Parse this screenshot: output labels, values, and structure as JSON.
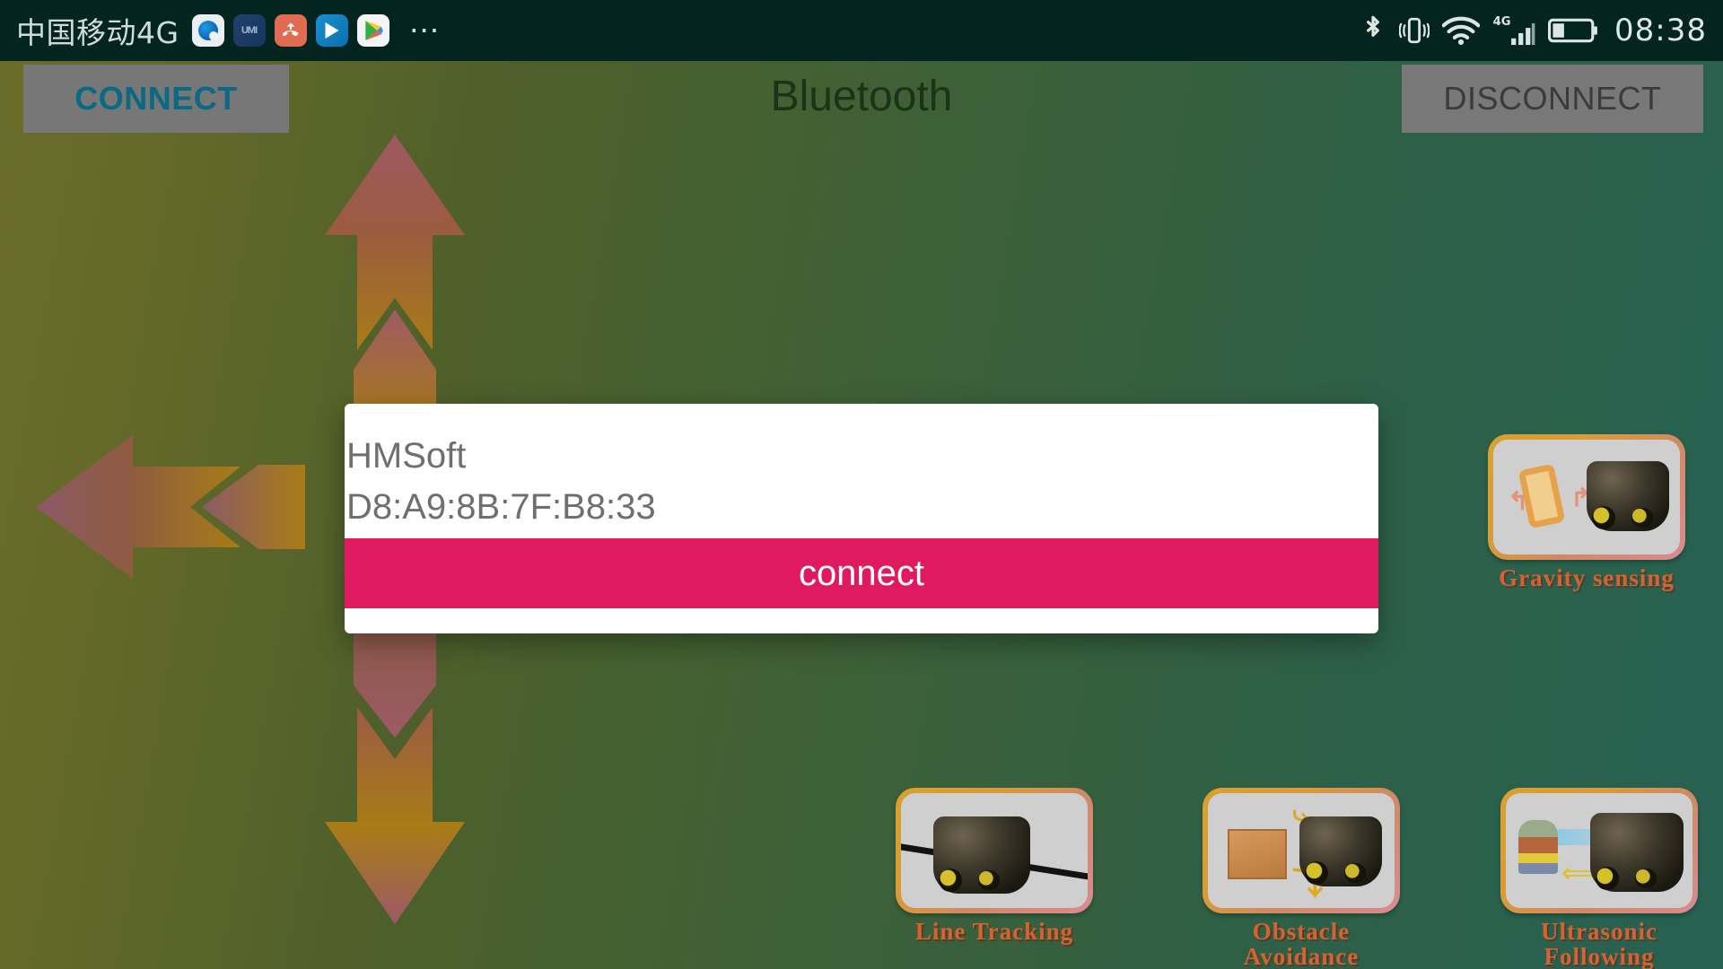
{
  "status_bar": {
    "carrier": "中国移动4G",
    "clock": "08:38",
    "app_icons": [
      {
        "name": "browser-icon",
        "label": ""
      },
      {
        "name": "umi-icon",
        "label": "UMI"
      },
      {
        "name": "missed-call-icon",
        "label": ""
      },
      {
        "name": "video-player-icon",
        "label": ""
      },
      {
        "name": "play-store-icon",
        "label": ""
      }
    ],
    "overflow": "⋯",
    "icons": [
      "bluetooth-icon",
      "vibrate-icon",
      "wifi-icon",
      "cellular-4g-icon",
      "battery-icon"
    ]
  },
  "app_bar": {
    "title": "Bluetooth",
    "connect_label": "CONNECT",
    "disconnect_label": "DISCONNECT"
  },
  "dpad": {
    "up": "arrow-up-control",
    "down": "arrow-down-control",
    "left": "arrow-left-control",
    "right": "arrow-right-control"
  },
  "cards": [
    {
      "id": "gravity",
      "label": "Gravity sensing"
    },
    {
      "id": "line",
      "label": "Line Tracking"
    },
    {
      "id": "obstacle",
      "label": "Obstacle\nAvoidance"
    },
    {
      "id": "ultra",
      "label": "Ultrasonic\nFollowing"
    }
  ],
  "card_labels": {
    "gravity": "Gravity sensing",
    "line": "Line Tracking",
    "obstacle_l1": "Obstacle",
    "obstacle_l2": "Avoidance",
    "ultra_l1": "Ultrasonic",
    "ultra_l2": "Following"
  },
  "dialog": {
    "device_name": "HMSoft",
    "device_address": "D8:A9:8B:7F:B8:33",
    "action_label": "connect"
  },
  "colors": {
    "status_bar_bg": "#042420",
    "bg_left": "#6b6c2a",
    "bg_right": "#276152",
    "connect_text": "#0b6a83",
    "disconnect_text": "#3b3b3b",
    "button_bg": "#777777",
    "dialog_accent": "#e01a5f",
    "dialog_text": "#6f6f6f",
    "title_text": "#1b3318",
    "card_label": "#d6632f"
  }
}
